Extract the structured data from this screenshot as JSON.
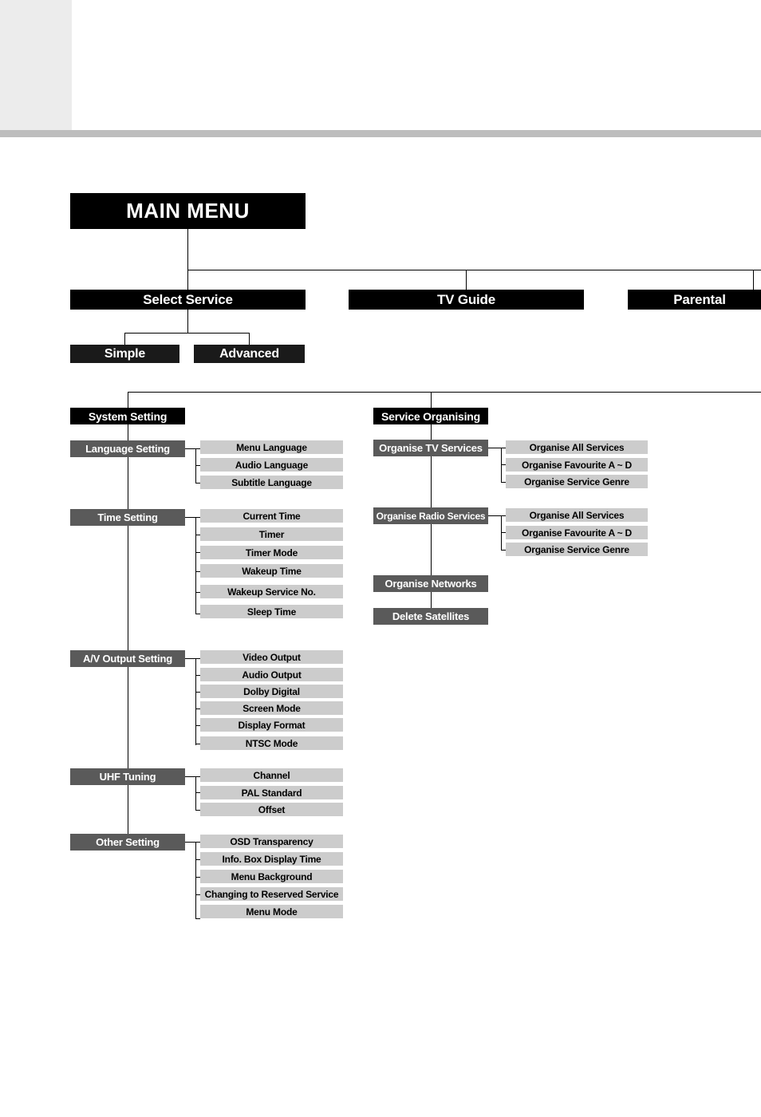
{
  "page": {
    "title": "MAIN MENU"
  },
  "root": {
    "label": "MAIN MENU"
  },
  "level1": [
    {
      "label": "Select Service"
    },
    {
      "label": "TV Guide"
    },
    {
      "label": "Parental"
    }
  ],
  "select_service_children": [
    {
      "label": "Simple"
    },
    {
      "label": "Advanced"
    }
  ],
  "system_setting": {
    "label": "System Setting",
    "groups": [
      {
        "label": "Language Setting",
        "items": [
          {
            "label": "Menu Language"
          },
          {
            "label": "Audio Language"
          },
          {
            "label": "Subtitle Language"
          }
        ]
      },
      {
        "label": "Time Setting",
        "items": [
          {
            "label": "Current Time"
          },
          {
            "label": "Timer"
          },
          {
            "label": "Timer Mode"
          },
          {
            "label": "Wakeup Time"
          },
          {
            "label": "Wakeup Service No."
          },
          {
            "label": "Sleep Time"
          }
        ]
      },
      {
        "label": "A/V Output Setting",
        "items": [
          {
            "label": "Video  Output"
          },
          {
            "label": "Audio Output"
          },
          {
            "label": "Dolby Digital"
          },
          {
            "label": "Screen Mode"
          },
          {
            "label": "Display Format"
          },
          {
            "label": "NTSC Mode"
          }
        ]
      },
      {
        "label": "UHF Tuning",
        "items": [
          {
            "label": "Channel"
          },
          {
            "label": "PAL Standard"
          },
          {
            "label": "Offset"
          }
        ]
      },
      {
        "label": "Other Setting",
        "items": [
          {
            "label": "OSD Transparency"
          },
          {
            "label": "Info. Box Display Time"
          },
          {
            "label": "Menu Background"
          },
          {
            "label": "Changing to Reserved Service"
          },
          {
            "label": "Menu Mode"
          }
        ]
      }
    ]
  },
  "service_organising": {
    "label": "Service Organising",
    "groups": [
      {
        "label": "Organise TV Services",
        "items": [
          {
            "label": "Organise All Services"
          },
          {
            "label": "Organise Favourite A ~ D"
          },
          {
            "label": "Organise  Service Genre"
          }
        ]
      },
      {
        "label": "Organise Radio Services",
        "items": [
          {
            "label": "Organise All Services"
          },
          {
            "label": "Organise Favourite A ~ D"
          },
          {
            "label": "Organise  Service Genre"
          }
        ]
      },
      {
        "label": "Organise Networks",
        "items": []
      },
      {
        "label": "Delete Satellites",
        "items": []
      }
    ]
  },
  "colors": {
    "level_1_2": "#000000",
    "level_3": "#5a5a5a",
    "level_4": "#cccccc",
    "header_block": "#ececec",
    "header_rule": "#bdbdbd"
  }
}
